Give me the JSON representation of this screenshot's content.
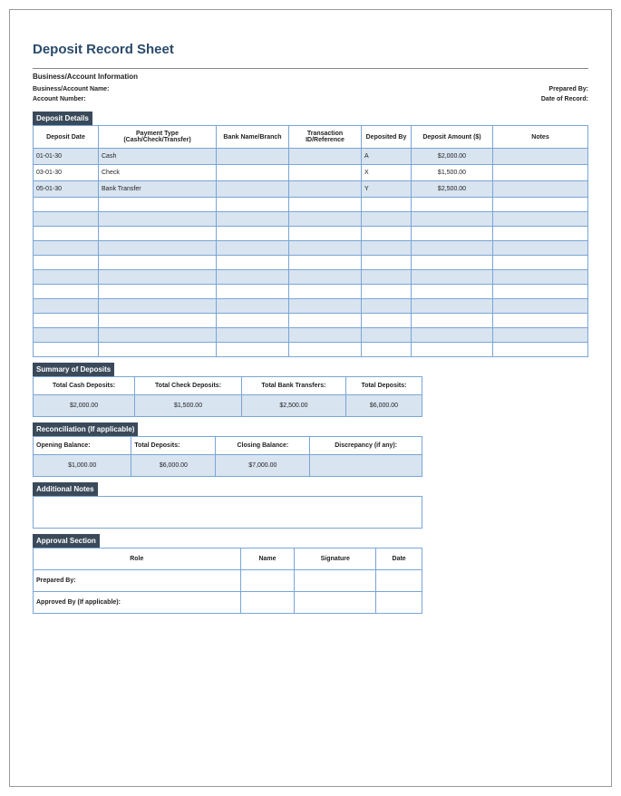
{
  "title": "Deposit Record Sheet",
  "business_info": {
    "section_label": "Business/Account Information",
    "business_label": "Business/Account Name:",
    "business_value": "",
    "prepared_label": "Prepared By:",
    "prepared_value": "",
    "account_label": "Account Number:",
    "account_value": "",
    "date_label": "Date of Record:",
    "date_value": ""
  },
  "deposit_details": {
    "section_label": "Deposit Details",
    "headers": {
      "date": "Deposit Date",
      "payment": "Payment Type (Cash/Check/Transfer)",
      "bank": "Bank Name/Branch",
      "transaction": "Transaction ID/Reference",
      "deposited_by": "Deposited By",
      "amount": "Deposit Amount ($)",
      "notes": "Notes"
    },
    "rows": [
      {
        "date": "01-01-30",
        "payment": "Cash",
        "bank": "",
        "transaction": "",
        "deposited_by": "A",
        "amount": "$2,000.00",
        "notes": "",
        "band": true
      },
      {
        "date": "03-01-30",
        "payment": "Check",
        "bank": "",
        "transaction": "",
        "deposited_by": "X",
        "amount": "$1,500.00",
        "notes": "",
        "band": false
      },
      {
        "date": "05-01-30",
        "payment": "Bank Transfer",
        "bank": "",
        "transaction": "",
        "deposited_by": "Y",
        "amount": "$2,500.00",
        "notes": "",
        "band": true
      },
      {
        "date": "",
        "payment": "",
        "bank": "",
        "transaction": "",
        "deposited_by": "",
        "amount": "",
        "notes": "",
        "band": false
      },
      {
        "date": "",
        "payment": "",
        "bank": "",
        "transaction": "",
        "deposited_by": "",
        "amount": "",
        "notes": "",
        "band": true
      },
      {
        "date": "",
        "payment": "",
        "bank": "",
        "transaction": "",
        "deposited_by": "",
        "amount": "",
        "notes": "",
        "band": false
      },
      {
        "date": "",
        "payment": "",
        "bank": "",
        "transaction": "",
        "deposited_by": "",
        "amount": "",
        "notes": "",
        "band": true
      },
      {
        "date": "",
        "payment": "",
        "bank": "",
        "transaction": "",
        "deposited_by": "",
        "amount": "",
        "notes": "",
        "band": false
      },
      {
        "date": "",
        "payment": "",
        "bank": "",
        "transaction": "",
        "deposited_by": "",
        "amount": "",
        "notes": "",
        "band": true
      },
      {
        "date": "",
        "payment": "",
        "bank": "",
        "transaction": "",
        "deposited_by": "",
        "amount": "",
        "notes": "",
        "band": false
      },
      {
        "date": "",
        "payment": "",
        "bank": "",
        "transaction": "",
        "deposited_by": "",
        "amount": "",
        "notes": "",
        "band": true
      },
      {
        "date": "",
        "payment": "",
        "bank": "",
        "transaction": "",
        "deposited_by": "",
        "amount": "",
        "notes": "",
        "band": false
      },
      {
        "date": "",
        "payment": "",
        "bank": "",
        "transaction": "",
        "deposited_by": "",
        "amount": "",
        "notes": "",
        "band": true
      },
      {
        "date": "",
        "payment": "",
        "bank": "",
        "transaction": "",
        "deposited_by": "",
        "amount": "",
        "notes": "",
        "band": false
      }
    ]
  },
  "summary": {
    "section_label": "Summary of Deposits",
    "headers": {
      "cash": "Total Cash Deposits:",
      "check": "Total Check Deposits:",
      "bank": "Total Bank Transfers:",
      "total": "Total Deposits:"
    },
    "row": {
      "cash": "$2,000.00",
      "check": "$1,500.00",
      "bank": "$2,500.00",
      "total": "$6,000.00"
    }
  },
  "reconciliation": {
    "section_label": "Reconciliation (If applicable)",
    "headers": {
      "opening": "Opening Balance:",
      "total": "Total Deposits:",
      "closing": "Closing Balance:",
      "discrepancy": "Discrepancy (if any):"
    },
    "row": {
      "opening": "$1,000.00",
      "total": "$6,000.00",
      "closing": "$7,000.00",
      "discrepancy": ""
    }
  },
  "notes": {
    "section_label": "Additional Notes"
  },
  "approval": {
    "section_label": "Approval Section",
    "headers": {
      "role": "Role",
      "name": "Name",
      "signature": "Signature",
      "date": "Date"
    },
    "rows": [
      {
        "role": "Prepared By:",
        "name": "",
        "signature": "",
        "date": ""
      },
      {
        "role": "Approved By (If applicable):",
        "name": "",
        "signature": "",
        "date": ""
      }
    ]
  }
}
